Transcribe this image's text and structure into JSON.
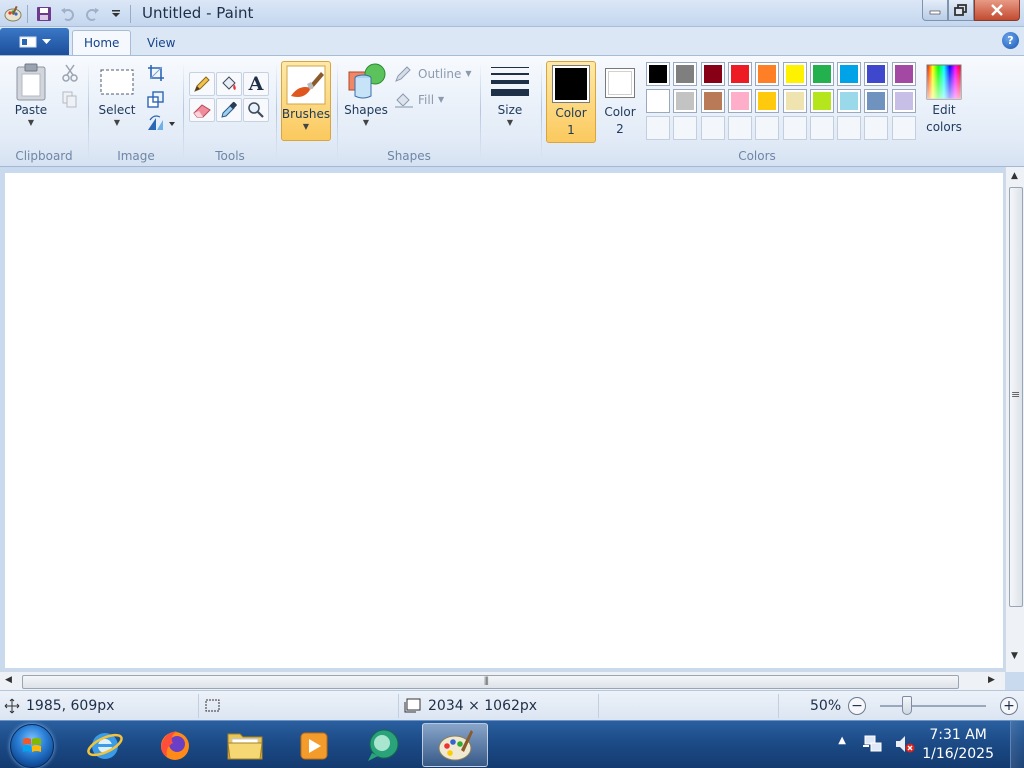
{
  "window": {
    "title": "Untitled - Paint"
  },
  "tabs": [
    {
      "label": "Home"
    },
    {
      "label": "View"
    }
  ],
  "help": {
    "label": "?"
  },
  "ribbon": {
    "clipboard": {
      "label": "Clipboard",
      "paste": "Paste"
    },
    "image": {
      "label": "Image",
      "select": "Select"
    },
    "tools": {
      "label": "Tools",
      "text_glyph": "A"
    },
    "brushes": {
      "label": "Brushes"
    },
    "shapes": {
      "label": "Shapes",
      "shapes_btn": "Shapes",
      "outline": "Outline",
      "fill": "Fill"
    },
    "size": {
      "label": "Size"
    },
    "colors": {
      "label": "Colors",
      "color1_line1": "Color",
      "color1_line2": "1",
      "color2_line1": "Color",
      "color2_line2": "2",
      "edit_line1": "Edit",
      "edit_line2": "colors",
      "color1_value": "#000000",
      "color2_value": "#ffffff",
      "row1": [
        "#000000",
        "#7f7f7f",
        "#880015",
        "#ed1c24",
        "#ff7f27",
        "#fff200",
        "#22b14c",
        "#00a2e8",
        "#3f48cc",
        "#a349a4"
      ],
      "row2": [
        "#ffffff",
        "#c3c3c3",
        "#b97a57",
        "#ffaec9",
        "#ffc90e",
        "#efe4b0",
        "#b5e61d",
        "#99d9ea",
        "#7092be",
        "#c8bfe7"
      ]
    }
  },
  "status": {
    "cursor_pos": "1985, 609px",
    "canvas_size": "2034 × 1062px",
    "zoom": "50%",
    "zoom_fraction": 0.25
  },
  "taskbar": {
    "time": "7:31 AM",
    "date": "1/16/2025"
  }
}
